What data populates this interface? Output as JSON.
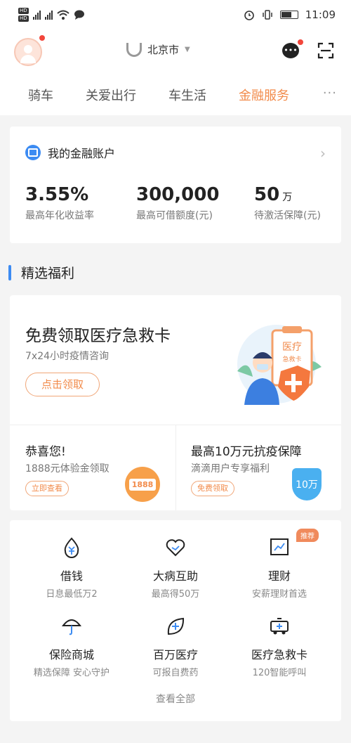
{
  "status_bar": {
    "network_labels": [
      "HD",
      "HD"
    ],
    "time": "11:09"
  },
  "header": {
    "city": "北京市"
  },
  "tabs": [
    {
      "label": "骑车"
    },
    {
      "label": "关爱出行"
    },
    {
      "label": "车生活"
    },
    {
      "label": "金融服务",
      "active": true
    }
  ],
  "more_label": "···",
  "account": {
    "title": "我的金融账户",
    "stats": [
      {
        "value": "3.55%",
        "unit": "",
        "label": "最高年化收益率"
      },
      {
        "value": "300,000",
        "unit": "",
        "label": "最高可借额度(元)"
      },
      {
        "value": "50",
        "unit": "万",
        "label": "待激活保障(元)"
      }
    ]
  },
  "welfare": {
    "section_title": "精选福利",
    "main": {
      "title": "免费领取医疗急救卡",
      "subtitle": "7x24小时疫情咨询",
      "button": "点击领取",
      "illustration_label": "医疗",
      "illustration_sub": "急救卡"
    },
    "left": {
      "title": "恭喜您!",
      "subtitle": "1888元体验金领取",
      "button": "立即查看",
      "badge": "1888"
    },
    "right": {
      "title": "最高10万元抗疫保障",
      "subtitle": "滴滴用户专享福利",
      "button": "免费领取",
      "badge": "10万"
    }
  },
  "services": {
    "hot_tag": "推荐",
    "items": [
      {
        "name": "借钱",
        "desc": "日息最低万2",
        "icon": "money-drop-icon"
      },
      {
        "name": "大病互助",
        "desc": "最高得50万",
        "icon": "heart-hands-icon"
      },
      {
        "name": "理财",
        "desc": "安薪理财首选",
        "icon": "chart-trend-icon"
      },
      {
        "name": "保险商城",
        "desc": "精选保障 安心守护",
        "icon": "umbrella-icon"
      },
      {
        "name": "百万医疗",
        "desc": "可报自费药",
        "icon": "medical-leaf-icon"
      },
      {
        "name": "医疗急救卡",
        "desc": "120智能呼叫",
        "icon": "ambulance-icon"
      }
    ],
    "view_all": "查看全部"
  },
  "colors": {
    "accent": "#f28b4b",
    "blue": "#3c8bf2",
    "red_dot": "#f2463b"
  }
}
